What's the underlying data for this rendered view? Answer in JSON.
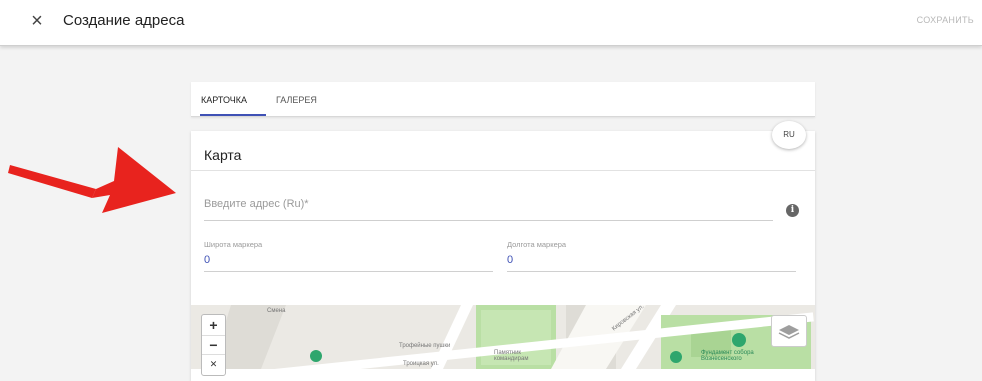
{
  "header": {
    "close_icon": "×",
    "title": "Создание адреса",
    "save_label": "СОХРАНИТЬ"
  },
  "tabs": [
    {
      "label": "КАРТОЧКА",
      "active": true
    },
    {
      "label": "ГАЛЕРЕЯ",
      "active": false
    }
  ],
  "card": {
    "title": "Карта",
    "lang_button": "RU",
    "address": {
      "placeholder": "Введите адрес (Ru)*",
      "value": ""
    },
    "info_icon": "i",
    "lat": {
      "label": "Широта маркера",
      "value": "0"
    },
    "lng": {
      "label": "Долгота маркера",
      "value": "0"
    }
  },
  "map": {
    "zoom_in": "+",
    "zoom_out": "−",
    "labels": [
      "Смена",
      "Трофейные пушки",
      "Памятник командирам",
      "Троицкая ул.",
      "Кировская ул.",
      "Фундамент собора Вознесенского"
    ]
  },
  "colors": {
    "accent": "#3f51b5",
    "annotation_arrow": "#e8231e",
    "park_green": "#b9dfa4"
  }
}
